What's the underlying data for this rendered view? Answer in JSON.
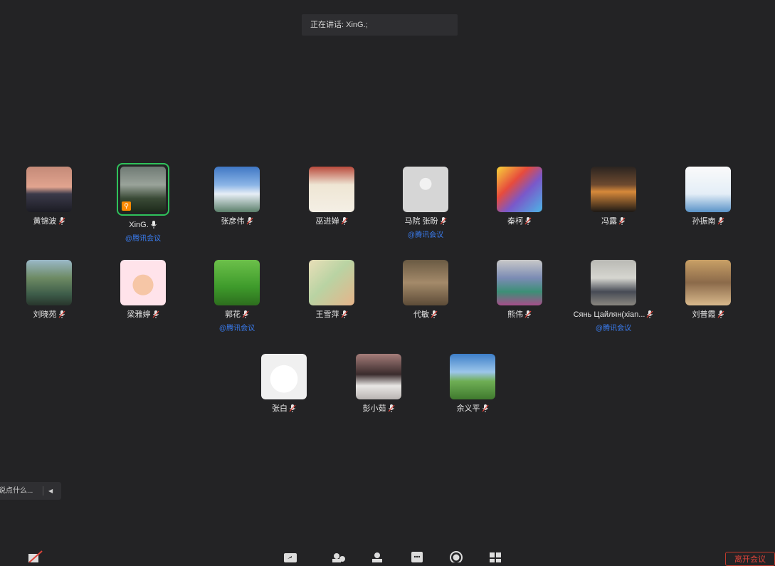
{
  "speaking_banner": "正在讲话: XinG.;",
  "participants": [
    {
      "name": "黄锦波",
      "tag": "",
      "active": false
    },
    {
      "name": "XinG.",
      "tag": "@腾讯会议",
      "active": true
    },
    {
      "name": "张彦伟",
      "tag": "",
      "active": false
    },
    {
      "name": "巫进婵",
      "tag": "",
      "active": false
    },
    {
      "name": "马院 张盼",
      "tag": "@腾讯会议",
      "active": false
    },
    {
      "name": "秦柯",
      "tag": "",
      "active": false
    },
    {
      "name": "冯露",
      "tag": "",
      "active": false
    },
    {
      "name": "孙振南",
      "tag": "",
      "active": false
    },
    {
      "name": "刘晓苑",
      "tag": "",
      "active": false
    },
    {
      "name": "梁雅婷",
      "tag": "",
      "active": false
    },
    {
      "name": "郭花",
      "tag": "@腾讯会议",
      "active": false
    },
    {
      "name": "王雪萍",
      "tag": "",
      "active": false
    },
    {
      "name": "代敏",
      "tag": "",
      "active": false
    },
    {
      "name": "熊伟",
      "tag": "",
      "active": false
    },
    {
      "name": "Сянь Цайлян(xian...",
      "tag": "@腾讯会议",
      "active": false
    },
    {
      "name": "刘普霞",
      "tag": "",
      "active": false
    },
    {
      "name": "张白",
      "tag": "",
      "active": false
    },
    {
      "name": "彭小茹",
      "tag": "",
      "active": false
    },
    {
      "name": "余义平",
      "tag": "",
      "active": false
    }
  ],
  "chat_placeholder": "说点什么...",
  "leave_button": "离开会议",
  "colors": {
    "background": "#232325",
    "active_border": "#2fc25b",
    "tag": "#3a7cf0",
    "leave": "#e0443a"
  }
}
